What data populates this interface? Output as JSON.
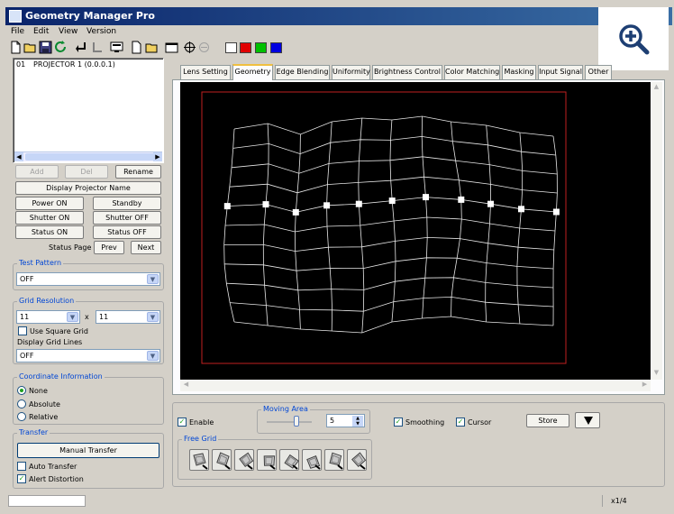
{
  "window": {
    "title": "Geometry Manager Pro"
  },
  "menu": [
    "File",
    "Edit",
    "View",
    "Version"
  ],
  "toolbar": {
    "icons": [
      "new-file-icon",
      "open-folder-icon",
      "save-icon",
      "refresh-icon",
      "undo-icon",
      "corner-icon",
      "monitor-icon",
      "new-doc-icon",
      "folder-icon",
      "window-icon",
      "crosshair-icon",
      "minus-circle-icon"
    ],
    "colors": [
      "#ffffff",
      "#e00000",
      "#00c000",
      "#0000e0"
    ]
  },
  "projector_list": {
    "items": [
      {
        "index": "01",
        "name": "PROJECTOR 1 (0.0.0.1)"
      }
    ]
  },
  "list_buttons": {
    "add": "Add",
    "del": "Del",
    "rename": "Rename"
  },
  "buttons": {
    "display_projector_name": "Display Projector Name",
    "power_on": "Power ON",
    "standby": "Standby",
    "shutter_on": "Shutter ON",
    "shutter_off": "Shutter OFF",
    "status_on": "Status ON",
    "status_off": "Status OFF",
    "status_page": "Status Page",
    "prev": "Prev",
    "next": "Next"
  },
  "test_pattern": {
    "label": "Test Pattern",
    "value": "OFF"
  },
  "grid_resolution": {
    "label": "Grid Resolution",
    "x_value": "11",
    "separator": "x",
    "y_value": "11",
    "use_square_grid": "Use Square Grid",
    "display_grid_lines_label": "Display Grid Lines",
    "display_grid_lines_value": "OFF"
  },
  "coordinate_information": {
    "label": "Coordinate Information",
    "options": [
      "None",
      "Absolute",
      "Relative"
    ],
    "selected": "None"
  },
  "transfer": {
    "label": "Transfer",
    "manual_transfer": "Manual Transfer",
    "auto_transfer": "Auto Transfer",
    "alert_distortion": "Alert Distortion"
  },
  "tabs": [
    "Lens Setting",
    "Geometry",
    "Edge Blending",
    "Uniformity",
    "Brightness Control",
    "Color Matching",
    "Masking",
    "Input Signal",
    "Other"
  ],
  "active_tab": "Geometry",
  "bottom_panel": {
    "enable": "Enable",
    "moving_area_label": "Moving Area",
    "moving_area_value": "5",
    "smoothing": "Smoothing",
    "cursor": "Cursor",
    "store": "Store",
    "free_grid_label": "Free Grid",
    "free_grid_tools": [
      "warp-tool-1-icon",
      "warp-tool-2-icon",
      "warp-tool-3-icon",
      "warp-tool-4-icon",
      "warp-tool-5-icon",
      "warp-tool-6-icon",
      "warp-tool-7-icon",
      "warp-tool-8-icon"
    ]
  },
  "statusbar": {
    "zoom": "x1/4"
  }
}
